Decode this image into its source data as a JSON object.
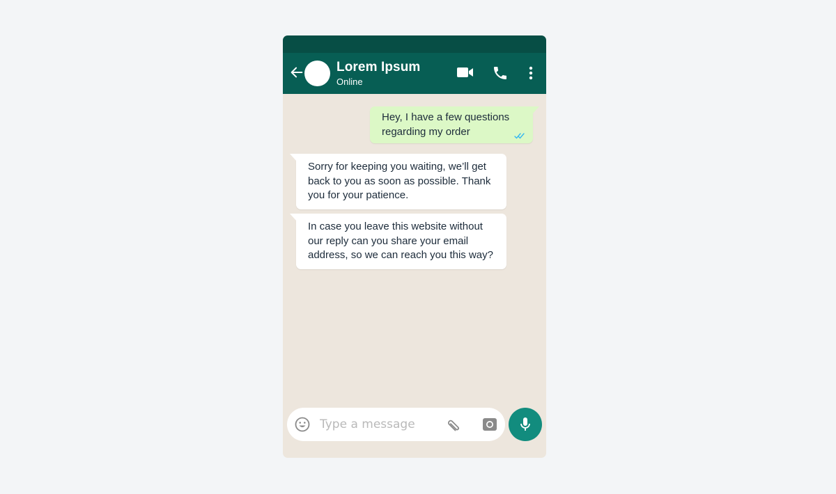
{
  "header": {
    "contact_name": "Lorem Ipsum",
    "contact_status": "Online",
    "icons": [
      "arrow-left-icon",
      "avatar",
      "video-camera-icon",
      "phone-icon",
      "more-vertical-icon"
    ]
  },
  "messages": [
    {
      "direction": "outgoing",
      "text": "Hey, I have a few questions regarding my order",
      "status": "read"
    },
    {
      "direction": "incoming",
      "text": "Sorry for keeping you waiting, we’ll get back to you as soon as possible. Thank you for your patience."
    },
    {
      "direction": "incoming",
      "text": "In case you leave this website without our reply can you share your email address, so we can reach you this way?"
    }
  ],
  "composer": {
    "placeholder": "Type a message",
    "value": "",
    "icons": [
      "emoji-icon",
      "paperclip-icon",
      "camera-icon",
      "microphone-icon"
    ]
  },
  "colors": {
    "header": "#075e54",
    "status_bar": "#074e45",
    "chat_background": "#ede6dd",
    "outgoing_bubble": "#dcf8c6",
    "incoming_bubble": "#ffffff",
    "read_ticks": "#34b7f1",
    "mic_button": "#128c7e"
  }
}
